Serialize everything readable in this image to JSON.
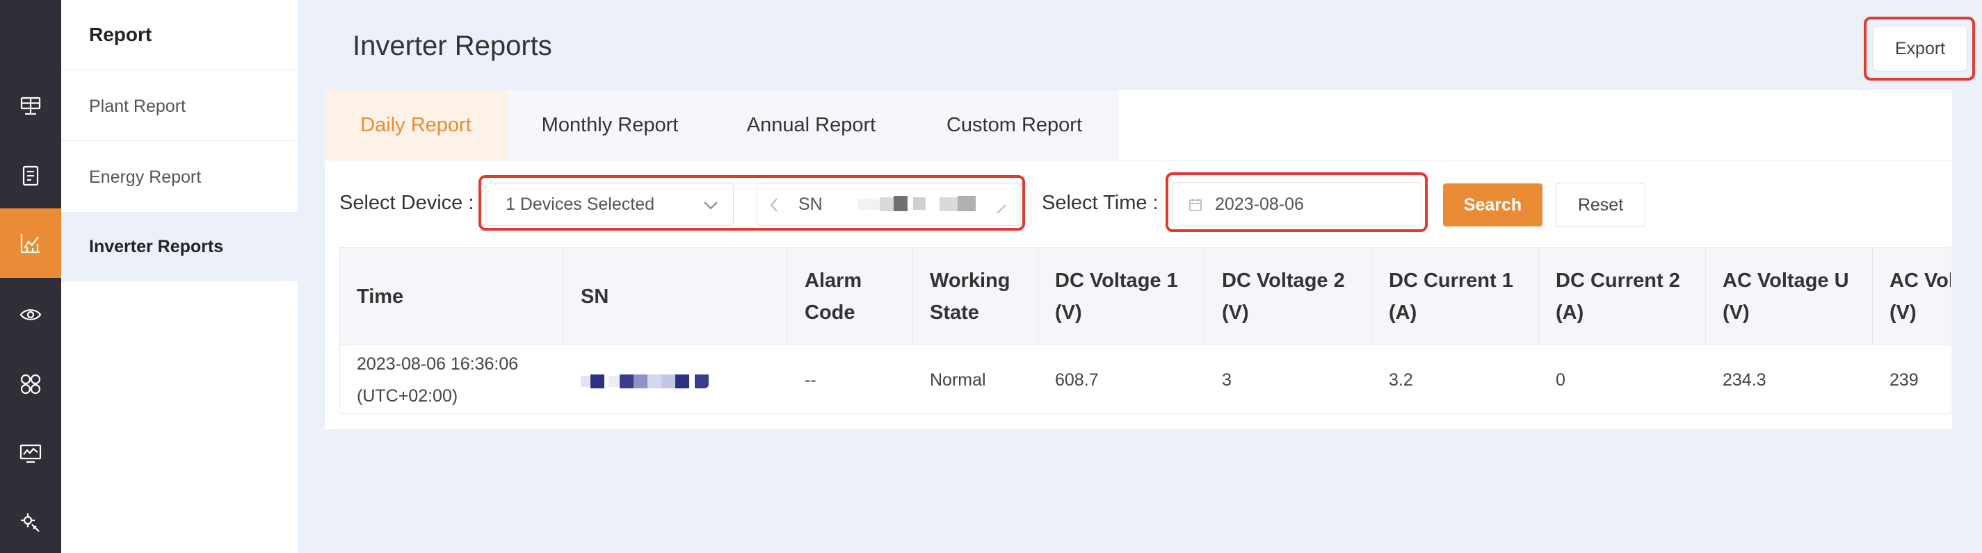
{
  "rail": {
    "items": [
      {
        "icon": "solar-panel-icon",
        "active": false
      },
      {
        "icon": "device-list-icon",
        "active": false
      },
      {
        "icon": "chart-icon",
        "active": true
      },
      {
        "icon": "eye-icon",
        "active": false
      },
      {
        "icon": "apps-grid-icon",
        "active": false
      },
      {
        "icon": "monitor-icon",
        "active": false
      },
      {
        "icon": "settings-wrench-icon",
        "active": false
      }
    ]
  },
  "subnav": {
    "title": "Report",
    "items": [
      {
        "label": "Plant Report",
        "active": false
      },
      {
        "label": "Energy Report",
        "active": false
      },
      {
        "label": "Inverter Reports",
        "active": true
      }
    ]
  },
  "header": {
    "title": "Inverter Reports",
    "export_label": "Export"
  },
  "tabs": [
    {
      "label": "Daily Report",
      "active": true
    },
    {
      "label": "Monthly Report",
      "active": false
    },
    {
      "label": "Annual Report",
      "active": false
    },
    {
      "label": "Custom Report",
      "active": false
    }
  ],
  "filters": {
    "device_label": "Select Device :",
    "device_value": "1 Devices Selected",
    "sn_prefix": "SN",
    "time_label": "Select Time :",
    "date_value": "2023-08-06",
    "search_label": "Search",
    "reset_label": "Reset"
  },
  "table": {
    "headers": [
      [
        "Time"
      ],
      [
        "SN"
      ],
      [
        "Alarm",
        "Code"
      ],
      [
        "Working",
        "State"
      ],
      [
        "DC Voltage 1",
        "(V)"
      ],
      [
        "DC Voltage 2",
        "(V)"
      ],
      [
        "DC Current 1",
        "(A)"
      ],
      [
        "DC Current 2",
        "(A)"
      ],
      [
        "AC Voltage U",
        "(V)"
      ],
      [
        "AC Vol",
        "(V)"
      ]
    ],
    "row": {
      "time": [
        "2023-08-06 16:36:06",
        "(UTC+02:00)"
      ],
      "alarm_code": "--",
      "working_state": "Normal",
      "dc_voltage_1": "608.7",
      "dc_voltage_2": "3",
      "dc_current_1": "3.2",
      "dc_current_2": "0",
      "ac_voltage_u": "234.3",
      "ac_voltage_v": "239"
    }
  },
  "colors": {
    "accent": "#ea8b35",
    "highlight": "#e23b2e",
    "rail": "#2f3037",
    "background": "#ecf0f8"
  }
}
